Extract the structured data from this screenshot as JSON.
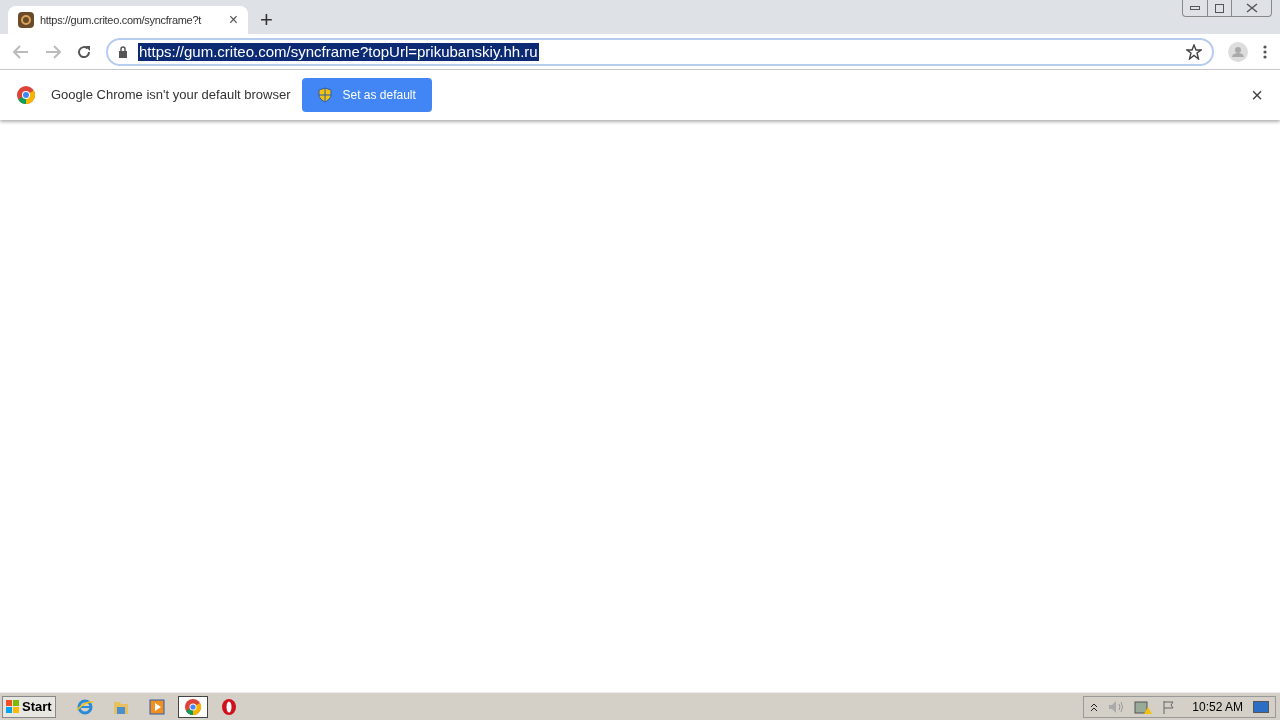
{
  "tab": {
    "title": "https://gum.criteo.com/syncframe?t",
    "close": "×",
    "new_tab": "+"
  },
  "address_bar": {
    "url": "https://gum.criteo.com/syncframe?topUrl=prikubanskiy.hh.ru",
    "selected": true
  },
  "infobar": {
    "message": "Google Chrome isn't your default browser",
    "button": "Set as default",
    "close": "×"
  },
  "taskbar": {
    "start": "Start",
    "apps": [
      {
        "kind": "ie",
        "selected": false
      },
      {
        "kind": "folder",
        "selected": false
      },
      {
        "kind": "media",
        "selected": false
      },
      {
        "kind": "chrome",
        "selected": true
      },
      {
        "kind": "opera",
        "selected": false
      }
    ],
    "clock": "10:52 AM"
  }
}
